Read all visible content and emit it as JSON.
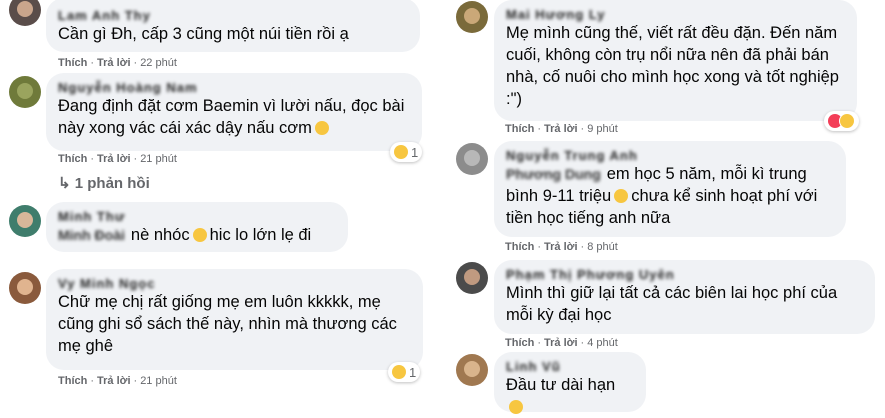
{
  "ui": {
    "like": "Thích",
    "reply": "Trả lời",
    "dot": "·"
  },
  "left": [
    {
      "name": "Lam Anh Thy",
      "text": "Cần gì Đh, cấp 3 cũng một núi tiền rồi ạ",
      "time": "22 phút"
    },
    {
      "name": "Nguyễn Hoàng Nam",
      "text": "Đang định đặt cơm Baemin vì lười nấu, đọc bài này xong vác cái xác dậy nấu cơm",
      "time": "21 phút",
      "reaction_count": "1"
    },
    {
      "replies": "1 phản hồi"
    },
    {
      "name": "Minh Thư",
      "tag": "Minh Đoài",
      "text": "nè nhóc",
      "text_after": "hic lo lớn lẹ đi"
    },
    {
      "name": "Vy Minh Ngọc",
      "text": "Chữ mẹ chị rất giống mẹ em luôn kkkkk, mẹ cũng ghi sổ sách thế này, nhìn mà thương các mẹ ghê",
      "time": "21 phút",
      "reaction_count": "1"
    }
  ],
  "right": [
    {
      "name": "Mai Hương Ly",
      "text": "Mẹ mình cũng thế, viết rất đều đặn. Đến năm cuối, không còn trụ nổi nữa nên đã phải bán nhà, cố nuôi cho mình học xong và tốt nghiệp :\")",
      "time": "9 phút"
    },
    {
      "name": "Nguyễn Trung Anh",
      "tag": "Phương Dung",
      "text": "em học 5 năm, mỗi kì trung bình 9-11 triệu",
      "text_after": "chưa kể sinh hoạt phí với tiền học tiếng anh nữa",
      "time": "8 phút"
    },
    {
      "name": "Phạm Thị Phương Uyên",
      "text": "Mình thì giữ lại tất cả các biên lai học phí của mỗi kỳ đại học",
      "time": "4 phút"
    },
    {
      "name": "Linh Vũ",
      "text": "Đầu tư dài hạn"
    }
  ]
}
